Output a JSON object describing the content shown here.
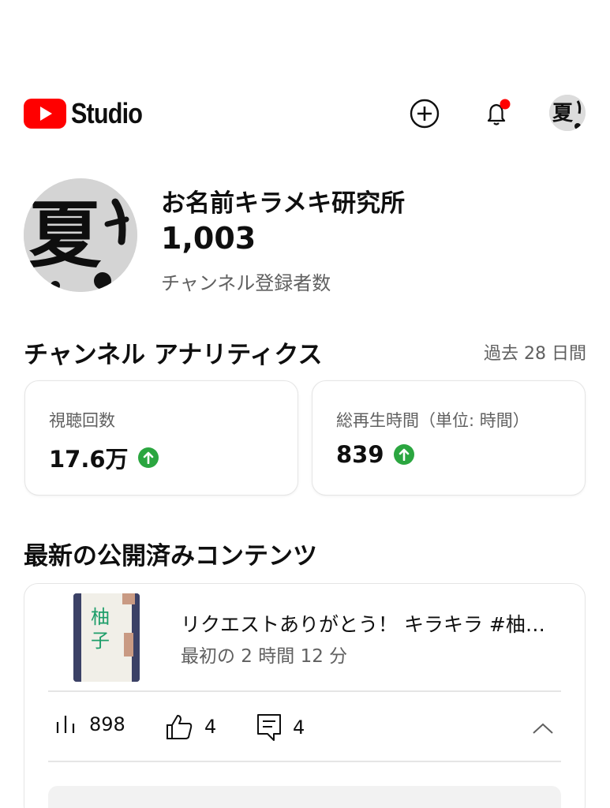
{
  "header": {
    "logo_text": "Studio",
    "icons": [
      "youtube-logo-icon",
      "create-plus-icon",
      "notification-bell-icon",
      "account-avatar"
    ],
    "notification_dot_color": "#ff0000",
    "brand_color": "#ff0000"
  },
  "channel": {
    "name": "お名前キラメキ研究所",
    "subscriber_count": "1,003",
    "subscriber_label": "チャンネル登録者数"
  },
  "analytics": {
    "title": "チャンネル アナリティクス",
    "period": "過去 28 日間",
    "cards": [
      {
        "label": "視聴回数",
        "value": "17.6万",
        "trend": "up"
      },
      {
        "label": "総再生時間（単位: 時間）",
        "value": "839",
        "trend": "up"
      }
    ],
    "trend_color": "#2ba640"
  },
  "latest": {
    "title": "最新の公開済みコンテンツ",
    "video": {
      "title": "リクエストありがとう！ キラキラ #柚…",
      "subtitle": "最初の 2 時間 12 分",
      "views": "898",
      "likes": "4",
      "comments": "4"
    }
  }
}
